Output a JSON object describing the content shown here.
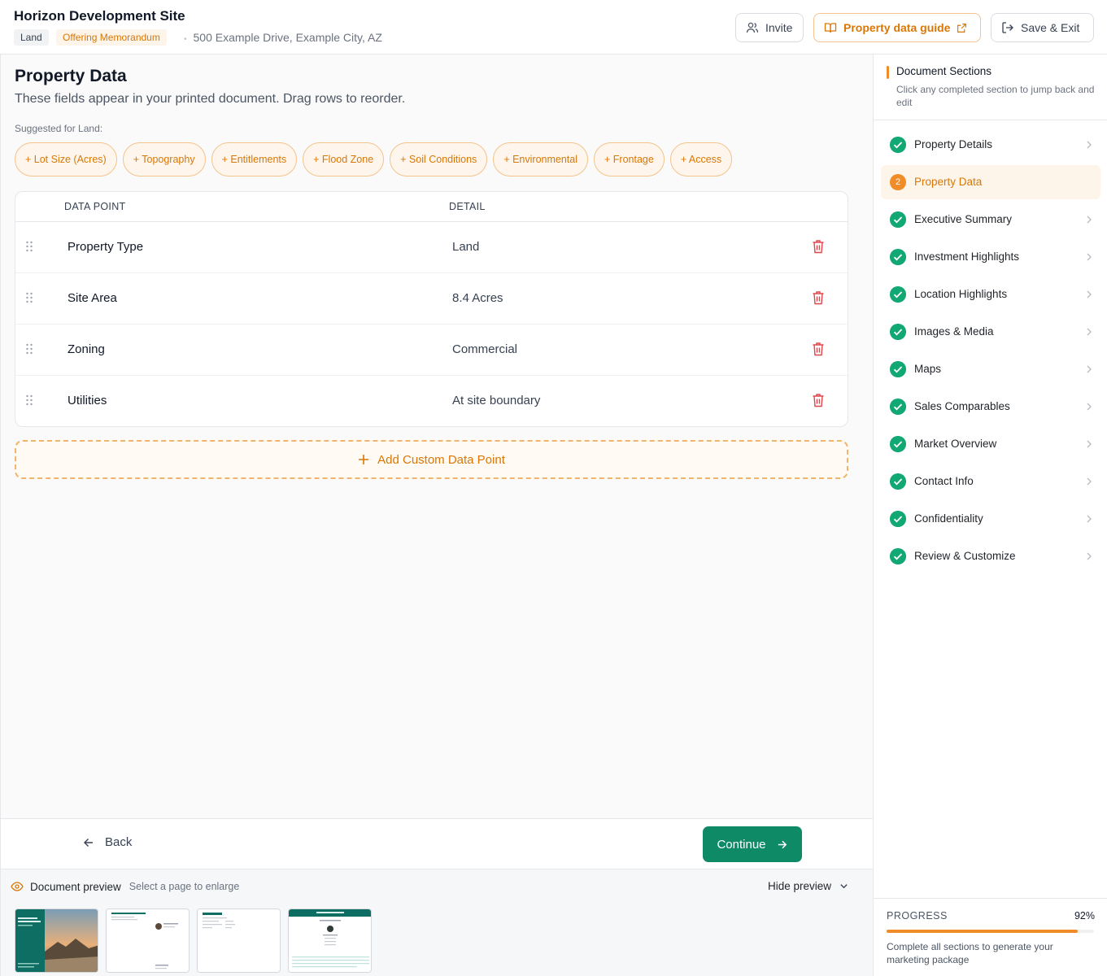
{
  "header": {
    "title": "Horizon Development Site",
    "tags": [
      "Land",
      "Offering Memorandum"
    ],
    "address": "500 Example Drive, Example City, AZ",
    "invite_label": "Invite",
    "guide_label": "Property data guide",
    "save_label": "Save & Exit"
  },
  "main": {
    "title": "Property Data",
    "subtitle": "These fields appear in your printed document. Drag rows to reorder.",
    "suggested_label": "Suggested for Land:",
    "suggestions": [
      "+ Lot Size (Acres)",
      "+ Topography",
      "+ Entitlements",
      "+ Flood Zone",
      "+ Soil Conditions",
      "+ Environmental",
      "+ Frontage",
      "+ Access"
    ],
    "table": {
      "headers": [
        "DATA POINT",
        "DETAIL"
      ],
      "rows": [
        {
          "key": "Property Type",
          "value": "Land"
        },
        {
          "key": "Site Area",
          "value": "8.4 Acres"
        },
        {
          "key": "Zoning",
          "value": "Commercial"
        },
        {
          "key": "Utilities",
          "value": "At site boundary"
        }
      ]
    },
    "add_custom_label": "Add Custom Data Point"
  },
  "nav": {
    "back_label": "Back",
    "continue_label": "Continue"
  },
  "preview": {
    "title": "Document preview",
    "hint": "Select a page to enlarge",
    "hide_label": "Hide preview",
    "page_count": 4
  },
  "sidebar": {
    "title": "Document Sections",
    "description": "Click any completed section to jump back and edit",
    "items": [
      {
        "label": "Property Details",
        "status": "done"
      },
      {
        "label": "Property Data",
        "status": "active",
        "number": "2"
      },
      {
        "label": "Executive Summary",
        "status": "done"
      },
      {
        "label": "Investment Highlights",
        "status": "done"
      },
      {
        "label": "Location Highlights",
        "status": "done"
      },
      {
        "label": "Images & Media",
        "status": "done"
      },
      {
        "label": "Maps",
        "status": "done"
      },
      {
        "label": "Sales Comparables",
        "status": "done"
      },
      {
        "label": "Market Overview",
        "status": "done"
      },
      {
        "label": "Contact Info",
        "status": "done"
      },
      {
        "label": "Confidentiality",
        "status": "done"
      },
      {
        "label": "Review & Customize",
        "status": "done"
      }
    ],
    "progress": {
      "label": "PROGRESS",
      "value": "92%",
      "fraction": 0.92,
      "note": "Complete all sections to generate your marketing package"
    }
  },
  "colors": {
    "accent_orange": "#f08c28",
    "primary_green": "#0f8a67",
    "success_green": "#12a874",
    "danger_red": "#e0454b"
  }
}
